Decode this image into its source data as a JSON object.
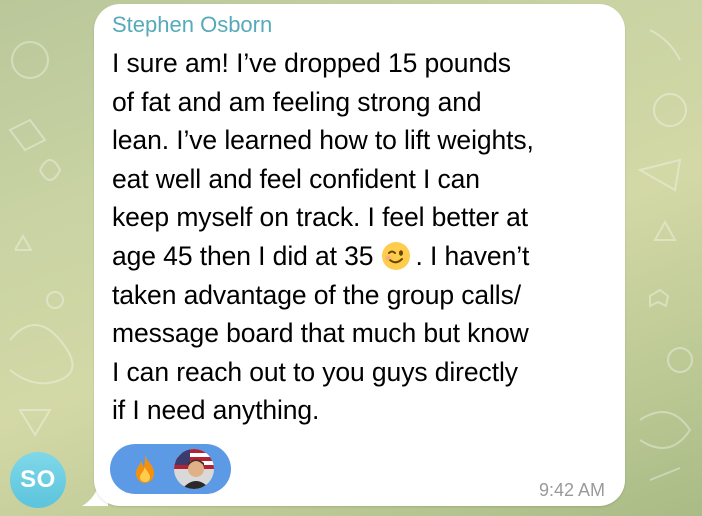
{
  "chat": {
    "sender_name": "Stephen Osborn",
    "avatar_initials": "SO",
    "avatar_color": "#6dd0e4",
    "sender_color": "#56aaba",
    "message_part1": "I sure am!  I’ve dropped 15 pounds\nof fat and am feeling strong and\nlean. I’ve learned how to lift weights,\neat well and feel confident I can\nkeep myself on track. I feel better at\nage 45 then I did at 35",
    "message_emoji": "winking-face-emoji",
    "message_part2": ". I haven’t\ntaken advantage of the group calls/\nmessage board that much but know\nI can reach out to you guys directly\nif I need anything.",
    "reactions": {
      "emoji": "fire-icon",
      "reactor": "flag-profile-avatar",
      "bg_color": "#5d9ae6"
    },
    "timestamp": "9:42 AM"
  }
}
